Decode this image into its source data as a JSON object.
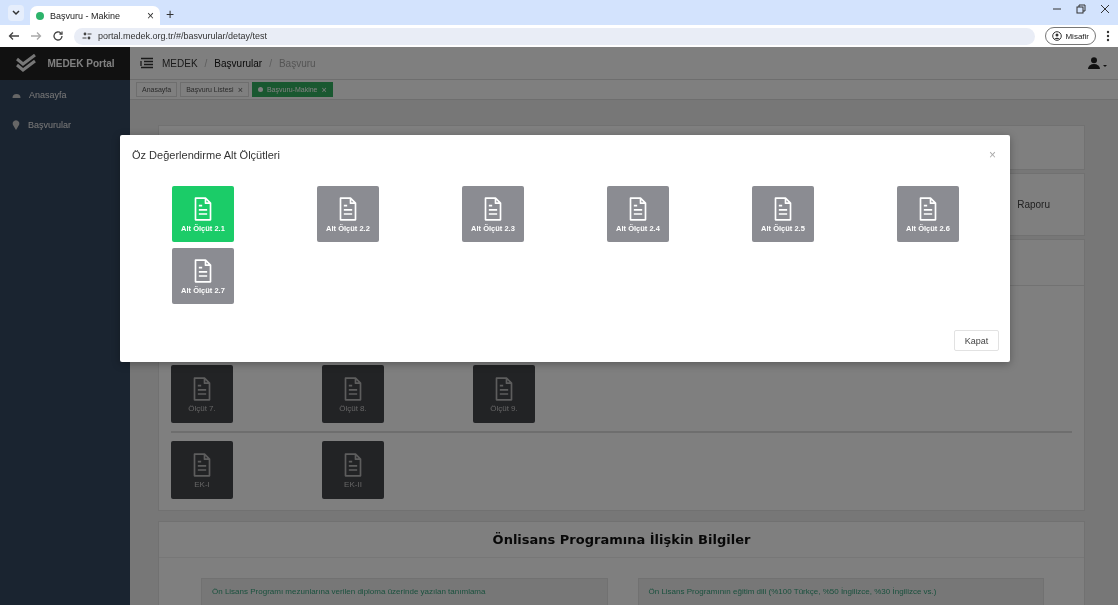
{
  "browser": {
    "tab_title": "Başvuru - Makine",
    "tab_close": "×",
    "new_tab": "+",
    "url": "portal.medek.org.tr/#/basvurular/detay/test",
    "profile_label": "Misafir"
  },
  "sidebar": {
    "brand": "MEDEK Portal",
    "items": [
      {
        "label": "Anasayfa",
        "kind": "home"
      },
      {
        "label": "Başvurular",
        "kind": "pin"
      }
    ]
  },
  "header": {
    "breadcrumb": [
      {
        "label": "MEDEK"
      },
      {
        "separator": "/",
        "label": "Başvurular"
      },
      {
        "separator": "/",
        "label": "Başvuru"
      }
    ]
  },
  "page_tabs": [
    {
      "label": "Anasayfa",
      "selected": false
    },
    {
      "label": "Başvuru Listesi",
      "close": "×",
      "selected": false
    },
    {
      "label": "Başvuru-Makine",
      "close": "×",
      "selected": true
    }
  ],
  "report_card": {
    "text": "Raporu"
  },
  "criteria": {
    "rows": [
      [
        "Ölçüt 7.",
        "Ölçüt 8.",
        "Ölçüt 9."
      ],
      [
        "EK-I",
        "EK-II"
      ]
    ]
  },
  "info_section": {
    "title": "Önlisans Programına İlişkin Bilgiler",
    "fields": [
      "Ön Lisans Programı mezunlarına verilen diploma üzerinde yazılan tanımlama",
      "Ön Lisans Programının eğitim dili (%100 Türkçe, %50 İngilizce, %30 İngilizce vs.)"
    ]
  },
  "modal": {
    "title": "Öz Değerlendirme Alt Ölçütleri",
    "close": "×",
    "items": [
      {
        "label": "Alt Ölçüt 2.1",
        "selected": true
      },
      {
        "label": "Alt Ölçüt 2.2",
        "selected": false
      },
      {
        "label": "Alt Ölçüt 2.3",
        "selected": false
      },
      {
        "label": "Alt Ölçüt 2.4",
        "selected": false
      },
      {
        "label": "Alt Ölçüt 2.5",
        "selected": false
      },
      {
        "label": "Alt Ölçüt 2.6",
        "selected": false
      },
      {
        "label": "Alt Ölçüt 2.7",
        "selected": false
      }
    ],
    "button": "Kapat"
  }
}
